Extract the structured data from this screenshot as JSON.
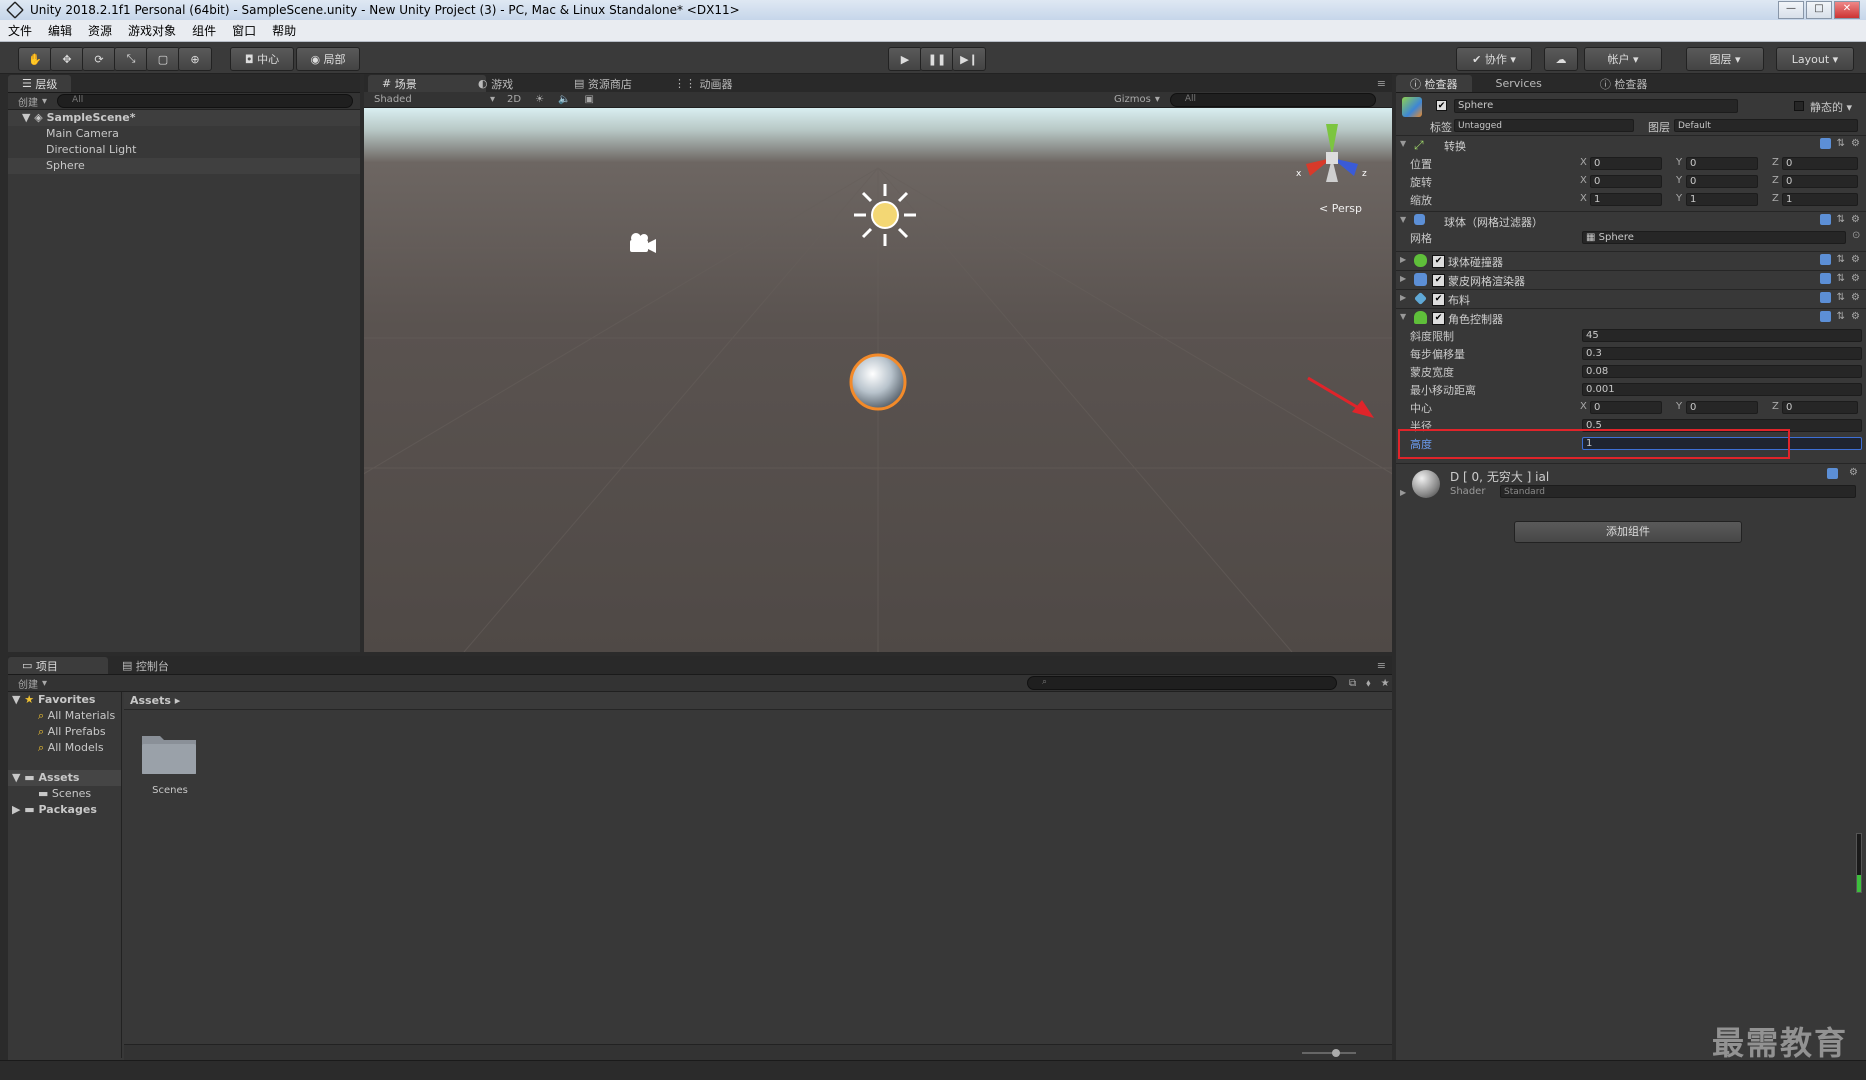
{
  "window": {
    "title": "Unity 2018.2.1f1 Personal (64bit) - SampleScene.unity - New Unity Project (3) - PC, Mac & Linux Standalone* <DX11>"
  },
  "menu": [
    "文件",
    "编辑",
    "资源",
    "游戏对象",
    "组件",
    "窗口",
    "帮助"
  ],
  "toolbar": {
    "pivot": "中心",
    "space": "局部",
    "collab": "协作",
    "account": "帐户",
    "layers": "图层",
    "layout": "Layout"
  },
  "hierarchy": {
    "tab": "层级",
    "create": "创建",
    "search_placeholder": "All",
    "scene": "SampleScene*",
    "objects": [
      "Main Camera",
      "Directional Light",
      "Sphere"
    ]
  },
  "scene_tabs": [
    "场景",
    "游戏",
    "资源商店",
    "动画器"
  ],
  "scene_bar": {
    "shading": "Shaded",
    "mode_2d": "2D",
    "gizmos": "Gizmos",
    "search_placeholder": "All",
    "persp": "Persp"
  },
  "inspector": {
    "tabs": [
      "检查器",
      "Services",
      "检查器"
    ],
    "object_name": "Sphere",
    "static_label": "静态的",
    "tag_label": "标签",
    "tag_value": "Untagged",
    "layer_label": "图层",
    "layer_value": "Default",
    "transform": {
      "title": "转换",
      "rows": [
        {
          "label": "位置",
          "x": "0",
          "y": "0",
          "z": "0"
        },
        {
          "label": "旋转",
          "x": "0",
          "y": "0",
          "z": "0"
        },
        {
          "label": "缩放",
          "x": "1",
          "y": "1",
          "z": "1"
        }
      ]
    },
    "mesh_filter": {
      "title": "球体（网格过滤器）",
      "mesh_label": "网格",
      "mesh_value": "Sphere"
    },
    "components": [
      "球体碰撞器",
      "蒙皮网格渲染器",
      "布料",
      "角色控制器"
    ],
    "character_controller": {
      "rows": [
        {
          "label": "斜度限制",
          "value": "45"
        },
        {
          "label": "每步偏移量",
          "value": "0.3"
        },
        {
          "label": "蒙皮宽度",
          "value": "0.08"
        },
        {
          "label": "最小移动距离",
          "value": "0.001"
        }
      ],
      "center_label": "中心",
      "center": {
        "x": "0",
        "y": "0",
        "z": "0"
      },
      "radius_label": "半径",
      "radius_value": "0.5",
      "height_label": "高度",
      "height_value": "1"
    },
    "material": {
      "name": "D [ 0, 无穷大 ] ial",
      "shader_label": "Shader",
      "shader_value": "Standard"
    },
    "add_component": "添加组件"
  },
  "project": {
    "tabs": [
      "项目",
      "控制台"
    ],
    "create": "创建",
    "favorites": "Favorites",
    "fav_items": [
      "All Materials",
      "All Prefabs",
      "All Models"
    ],
    "assets": "Assets",
    "assets_children": [
      "Scenes"
    ],
    "packages": "Packages",
    "breadcrumb": "Assets",
    "folder": "Scenes"
  },
  "watermark": "最需教育",
  "colors": {
    "highlight_box": "#e0242a",
    "selection_blue": "#3d6fd6",
    "panel_bg": "#383838"
  }
}
